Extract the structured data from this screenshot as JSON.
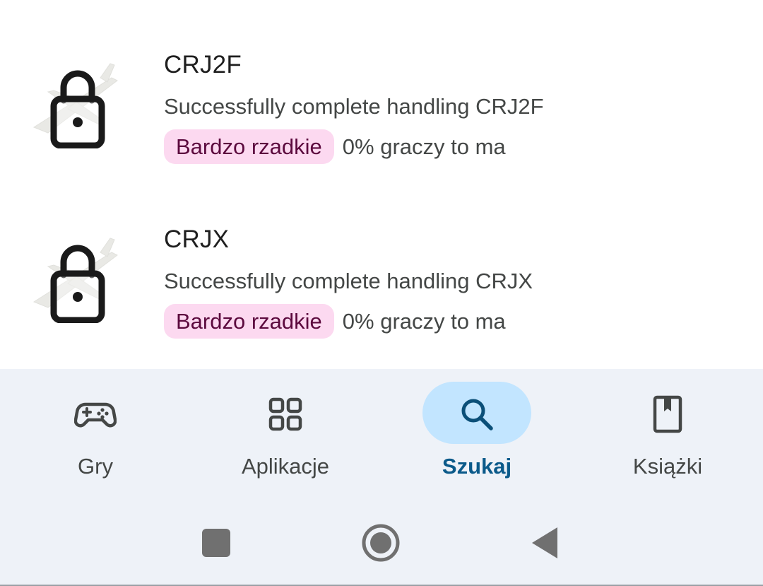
{
  "achievements": [
    {
      "title": "CRJ2F",
      "description": "Successfully complete handling CRJ2F",
      "rarity": "Bardzo rzadkie",
      "percent_text": "0% graczy to ma",
      "locked": true,
      "icon": "lock-icon"
    },
    {
      "title": "CRJX",
      "description": "Successfully complete handling CRJX",
      "rarity": "Bardzo rzadkie",
      "percent_text": "0% graczy to ma",
      "locked": true,
      "icon": "lock-icon"
    }
  ],
  "bottom_nav": {
    "items": [
      {
        "label": "Gry",
        "icon": "gamepad-icon",
        "active": false
      },
      {
        "label": "Aplikacje",
        "icon": "apps-grid-icon",
        "active": false
      },
      {
        "label": "Szukaj",
        "icon": "search-icon",
        "active": true
      },
      {
        "label": "Książki",
        "icon": "book-icon",
        "active": false
      }
    ]
  },
  "system_nav": {
    "buttons": [
      "recents-icon",
      "home-icon",
      "back-icon"
    ]
  },
  "colors": {
    "rarity_badge_bg": "#fcd9f0",
    "rarity_badge_text": "#5c0a3e",
    "nav_bg": "#eef2f8",
    "active_pill": "#c2e5ff",
    "active_label": "#0b5a8a"
  }
}
